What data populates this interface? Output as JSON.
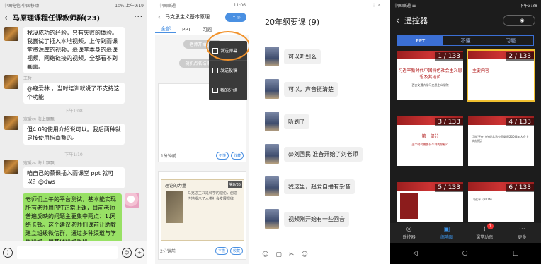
{
  "panel1": {
    "status_left": "中国电信·中国移动",
    "status_right": "10% 上午9:19",
    "title": "马原理课程任课教师群(23)",
    "messages": [
      {
        "text": "我没成功的经验，只有失败的体验。我尝试了插入本地视频，上传到雨课堂资源库的视频，慕课堂本身的慕课视频，网络链接的视频，全都看不到画面。"
      },
      {
        "sender": "王哲",
        "text": "@寇爱林 ，当时培训就说了不支持这个功能"
      },
      {
        "time": "下午1:08"
      },
      {
        "sender": "寇爱林 海上飘飘",
        "text": "但4.0的使用介绍说可以。我后两种就是按使用指南整的。"
      },
      {
        "time": "下午1:10"
      },
      {
        "sender": "寇爱林 海上飘飘",
        "text": "咱自己的慕课插入雨课堂 ppt 就可以？@dws"
      }
    ],
    "my_message": "老师们上午的平台测试，基本能实现所有老师用PPT正常上课，目前老师普遍反映的问题主要集中两点：1.网络卡顿。这个建议老师们课前让助教建立班级微信群，通过多种渠道与学生联络，用其他联络手段",
    "voice_icon": "voice-icon",
    "emoji_icon": "emoji-icon",
    "plus_icon": "plus-icon"
  },
  "panel2": {
    "status_left": "中国联通",
    "status_right": "11:06",
    "title": "马克思主义基本原理",
    "capsule": "··· ◎",
    "tabs": [
      "全部",
      "PPT",
      "习题"
    ],
    "pill1": "老师开始了…",
    "pill2": "随机点名结果：我",
    "time1": "1分钟前",
    "time2": "2分钟前",
    "btn_a": "不懂",
    "btn_b": "收藏",
    "menu": [
      "发送弹幕",
      "发送投稿",
      "我的分组"
    ],
    "slide_title": "理论的力量",
    "slide_page": "第8/35",
    "slide_text": "马克思主义是科学的理论，创造性地揭示了人类社会发展规律"
  },
  "panel3": {
    "status_icons": "⋮ ✕",
    "title": "20年纲要课 (9)",
    "messages": [
      "可以听到么",
      "可以，声音挺清楚",
      "听到了",
      "@刘国民 准备开始了刘老师",
      "我这里，赵爱自播有杂音",
      "视频刚开始有一些回音"
    ],
    "bottom_icons": [
      "☺",
      "▢",
      "✂",
      "☺"
    ]
  },
  "panel4": {
    "status_left": "中国联通 ☰",
    "status_right": "下午3:38",
    "title": "遥控器",
    "capsule": "··· ◉",
    "tabs": [
      "PPT",
      "不懂",
      "习题"
    ],
    "thumbs": [
      {
        "num": "1 / 133",
        "title": "习近平新时代中国特色社会主义思想及其地位",
        "sub": "西安交通大学马克思主义学院"
      },
      {
        "num": "2 / 133",
        "title": "主要内容",
        "sub": ""
      },
      {
        "num": "3 / 133",
        "title": "第一部分",
        "sub": "这个时代需要什么样的领袖？"
      },
      {
        "num": "4 / 133",
        "title": "",
        "sub": "习近平在《在纪念马克思诞辰200周年大会上的讲话》"
      },
      {
        "num": "5 / 133",
        "title": "",
        "sub": ""
      },
      {
        "num": "6 / 133",
        "title": "",
        "sub": "习近平（2016）"
      }
    ],
    "nav": [
      {
        "label": "遥控器",
        "icon": "◎"
      },
      {
        "label": "缩略图",
        "icon": "▣"
      },
      {
        "label": "课堂动态",
        "icon": "⌇",
        "badge": "1"
      },
      {
        "label": "更多",
        "icon": "⋯"
      }
    ],
    "sys": [
      "◁",
      "○",
      "□"
    ]
  }
}
